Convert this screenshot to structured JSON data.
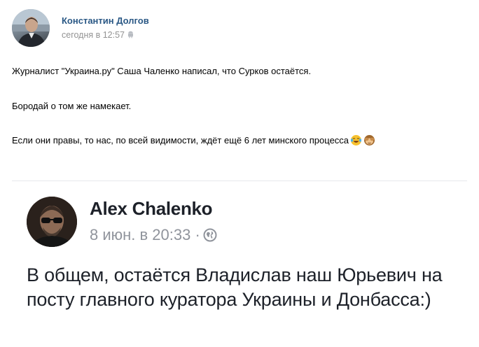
{
  "post": {
    "author": "Константин Долгов",
    "time": "сегодня в 12:57",
    "device_icon": "android-icon",
    "lines": [
      "Журналист \"Украина.ру\" Саша Чаленко написал, что Сурков остаётся.",
      "Бородай о том же намекает.",
      "Если они правы, то нас, по всей видимости, ждёт ещё 6 лет минского процесса"
    ],
    "emojis": [
      "laughing-tears-emoji",
      "see-no-evil-monkey-emoji"
    ]
  },
  "embedded": {
    "name": "Alex Chalenko",
    "date": "8 июн. в 20:33",
    "separator": "·",
    "privacy_icon": "globe-icon",
    "text": "В общем, остаётся Владислав наш Юрьевич на посту главного куратора Украины и Донбасса:)"
  }
}
